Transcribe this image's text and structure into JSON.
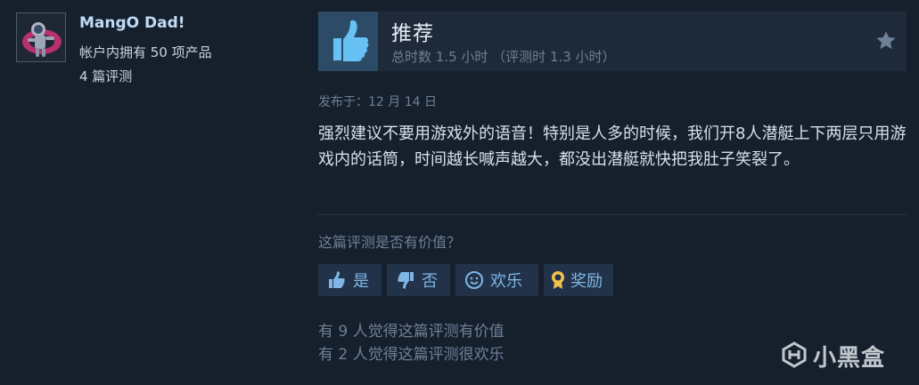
{
  "author": {
    "persona_name": "MangO Dad!",
    "products_owned": "帐户内拥有 50 项产品",
    "review_count": "4 篇评测",
    "avatar_icon": "astronaut-avatar-icon"
  },
  "review": {
    "verdict": "推荐",
    "hours": "总时数 1.5 小时 （评测时 1.3 小时）",
    "posted": "发布于：12 月 14 日",
    "text": "强烈建议不要用游戏外的语音！特别是人多的时候，我们开8人潜艇上下两层只用游戏内的话筒，时间越长喊声越大，都没出潜艇就快把我肚子笑裂了。",
    "thumb_icon": "thumbs-up-icon",
    "award_icon": "star-icon"
  },
  "vote": {
    "question": "这篇评测是否有价值？",
    "yes_label": "是",
    "no_label": "否",
    "funny_label": "欢乐",
    "award_label": "奖励",
    "helpful_stat": "有 9 人觉得这篇评测有价值",
    "funny_stat": "有 2 人觉得这篇评测很欢乐"
  },
  "watermark": {
    "text": "小黑盒"
  },
  "colors": {
    "background": "#16202d",
    "accent": "#7fb6e6",
    "thumb_bg": "#2b4b66"
  }
}
